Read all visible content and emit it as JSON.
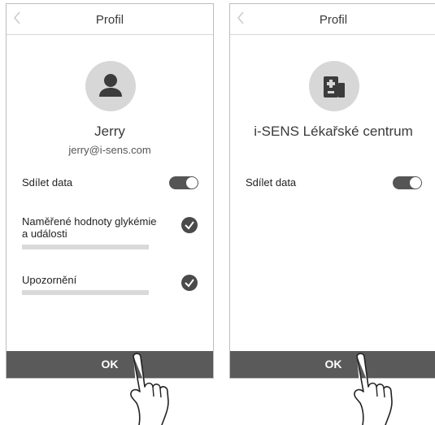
{
  "left": {
    "header": {
      "title": "Profil"
    },
    "profile": {
      "name": "Jerry",
      "email": "jerry@i-sens.com"
    },
    "share": {
      "label": "Sdílet data"
    },
    "items": [
      {
        "label_line1": "Naměřené hodnoty glykémie",
        "label_line2": "a události"
      },
      {
        "label_line1": "Upozornění"
      }
    ],
    "ok_label": "OK"
  },
  "right": {
    "header": {
      "title": "Profil"
    },
    "profile": {
      "name": "i-SENS Lékařské centrum"
    },
    "share": {
      "label": "Sdílet data"
    },
    "ok_label": "OK"
  },
  "colors": {
    "toggle_on": "#555555",
    "ok_bar": "#5a5a5a",
    "avatar_bg": "#d7d7d7"
  }
}
